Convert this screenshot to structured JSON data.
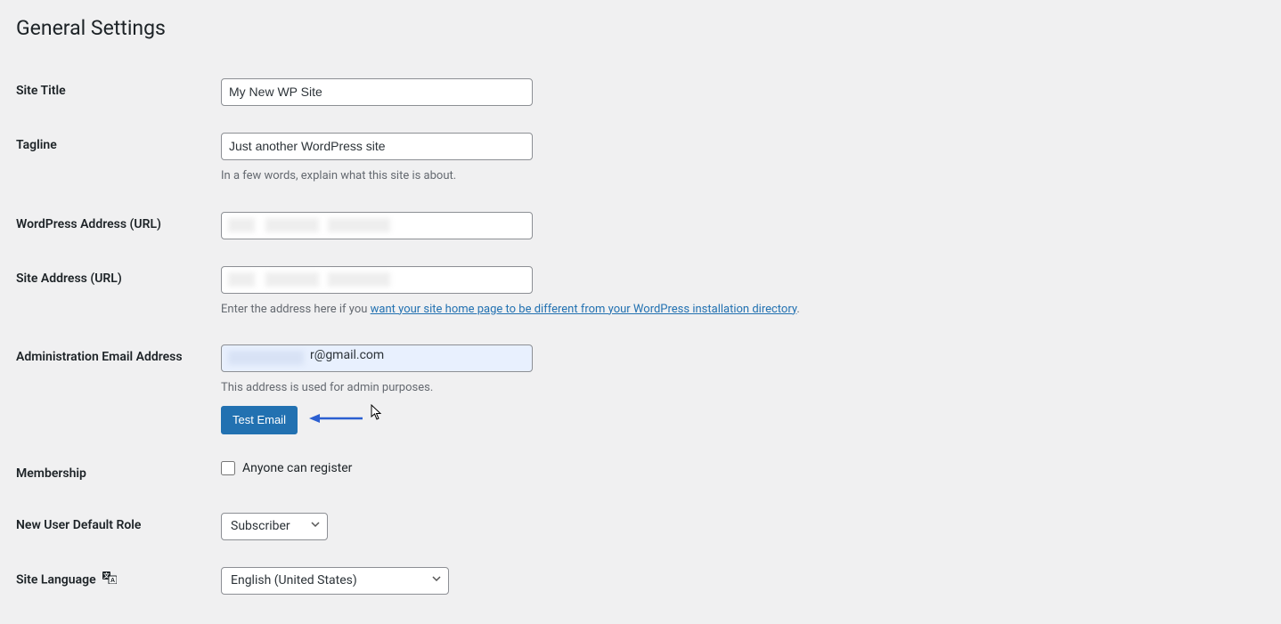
{
  "page": {
    "title": "General Settings"
  },
  "fields": {
    "site_title": {
      "label": "Site Title",
      "value": "My New WP Site"
    },
    "tagline": {
      "label": "Tagline",
      "value": "Just another WordPress site",
      "description": "In a few words, explain what this site is about."
    },
    "wp_address": {
      "label": "WordPress Address (URL)",
      "value": ""
    },
    "site_address": {
      "label": "Site Address (URL)",
      "value": "",
      "description_prefix": "Enter the address here if you ",
      "description_link": "want your site home page to be different from your WordPress installation directory",
      "description_suffix": "."
    },
    "admin_email": {
      "label": "Administration Email Address",
      "value_suffix": "r@gmail.com",
      "description": "This address is used for admin purposes.",
      "button": "Test Email"
    },
    "membership": {
      "label": "Membership",
      "checkbox_label": "Anyone can register",
      "checked": false
    },
    "default_role": {
      "label": "New User Default Role",
      "value": "Subscriber"
    },
    "site_language": {
      "label": "Site Language",
      "value": "English (United States)"
    }
  }
}
